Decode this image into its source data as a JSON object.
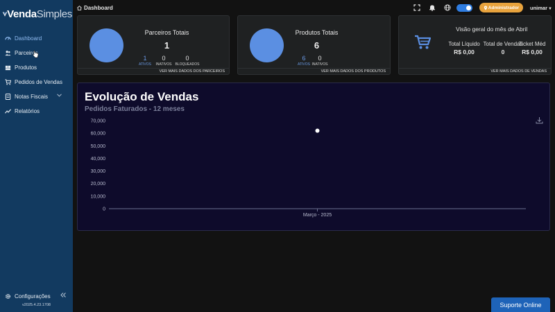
{
  "brand": {
    "bold": "Venda",
    "light": "Simples"
  },
  "sidebar": {
    "items": [
      {
        "label": "Dashboard",
        "icon": "dashboard-icon"
      },
      {
        "label": "Parceiros",
        "icon": "users-icon"
      },
      {
        "label": "Produtos",
        "icon": "box-icon"
      },
      {
        "label": "Pedidos de Vendas",
        "icon": "cart-icon"
      },
      {
        "label": "Notas Fiscais",
        "icon": "receipt-icon"
      },
      {
        "label": "Relatórios",
        "icon": "chart-icon"
      }
    ],
    "config_label": "Configurações",
    "version": "v2025.4.23.1708"
  },
  "topbar": {
    "breadcrumb": "Dashboard",
    "admin_label": "Administrador",
    "user": "unimar"
  },
  "cards": {
    "parceiros": {
      "title": "Parceiros Totais",
      "total": "1",
      "stats": [
        {
          "value": "1",
          "label": "ATIVOS"
        },
        {
          "value": "0",
          "label": "INATIVOS"
        },
        {
          "value": "0",
          "label": "BLOQUEADOS"
        }
      ],
      "footer": "VER MAIS DADOS DOS PARCEIROS"
    },
    "produtos": {
      "title": "Produtos Totais",
      "total": "6",
      "stats": [
        {
          "value": "6",
          "label": "ATIVOS"
        },
        {
          "value": "0",
          "label": "INATIVOS"
        }
      ],
      "footer": "VER MAIS DADOS DOS PRODUTOS"
    },
    "mes": {
      "title": "Visão geral do mês de Abril",
      "cols": [
        {
          "label": "Total Líquido",
          "value": "R$ 0,00"
        },
        {
          "label": "Total de Vendas",
          "value": "0"
        },
        {
          "label": "Ticket Méd",
          "value": "R$ 0,00"
        }
      ],
      "footer": "VER MAIS DADOS DE VENDAS"
    }
  },
  "chart": {
    "title": "Evolução de Vendas",
    "subtitle": "Pedidos Faturados - 12 meses"
  },
  "chart_data": {
    "type": "line",
    "title": "Evolução de Vendas",
    "subtitle": "Pedidos Faturados - 12 meses",
    "categories": [
      "Março - 2025"
    ],
    "series": [
      {
        "values": [
          62000
        ]
      }
    ],
    "ylim": [
      0,
      70000
    ],
    "yticks": [
      "0",
      "10,000",
      "20,000",
      "30,000",
      "40,000",
      "50,000",
      "60,000",
      "70,000"
    ],
    "grid": false,
    "point_color": "#ffffff"
  },
  "support": {
    "label": "Suporte Online"
  },
  "colors": {
    "sidebar": "#123a60",
    "accent": "#5b8fe2",
    "admin": "#e8a33d",
    "chart_bg": "#0e0b2b",
    "support": "#1e63b8"
  }
}
